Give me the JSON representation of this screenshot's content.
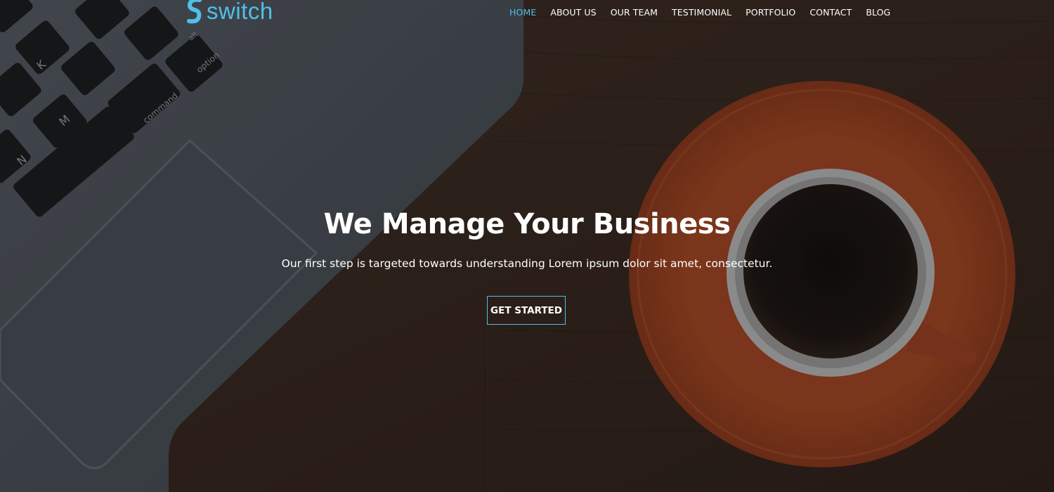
{
  "brand": {
    "name": "switch",
    "color": "#4fc0e8"
  },
  "nav": {
    "items": [
      {
        "label": "HOME",
        "active": true
      },
      {
        "label": "ABOUT US",
        "active": false
      },
      {
        "label": "OUR TEAM",
        "active": false
      },
      {
        "label": "TESTIMONIAL",
        "active": false
      },
      {
        "label": "PORTFOLIO",
        "active": false
      },
      {
        "label": "CONTACT",
        "active": false
      },
      {
        "label": "BLOG",
        "active": false
      }
    ],
    "active_color": "#4fc0e8",
    "text_color": "#ffffff"
  },
  "hero": {
    "headline": "We Manage Your Business",
    "subtitle": "Our first step is targeted towards understanding Lorem ipsum dolor sit amet, consectetur.",
    "cta_label": "GET STARTED",
    "cta_border_color": "#4fc0e8",
    "keyboard_keys": [
      "K",
      "M",
      "N",
      "option",
      "command",
      "alt"
    ]
  }
}
